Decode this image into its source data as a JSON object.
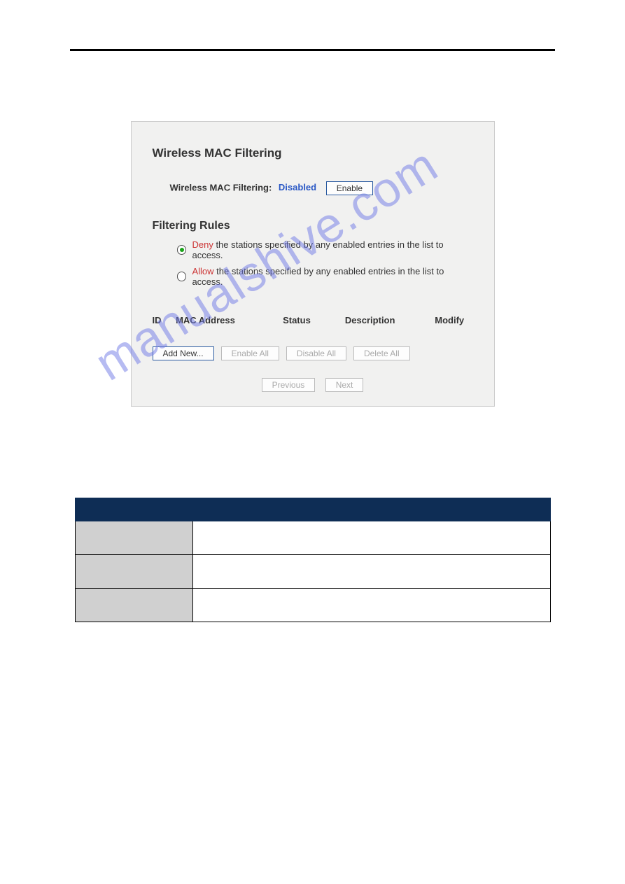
{
  "panel": {
    "title": "Wireless MAC Filtering",
    "status_label": "Wireless MAC Filtering:",
    "status_value": "Disabled",
    "enable_btn": "Enable",
    "rules_heading": "Filtering Rules",
    "rules": [
      {
        "selected": true,
        "key": "Deny",
        "rest": " the stations specified by any enabled entries in the list to access."
      },
      {
        "selected": false,
        "key": "Allow",
        "rest": " the stations specified by any enabled entries in the list to access."
      }
    ],
    "columns": {
      "id": "ID",
      "mac": "MAC Address",
      "status": "Status",
      "desc": "Description",
      "modify": "Modify"
    },
    "buttons": {
      "add": "Add New...",
      "enable_all": "Enable All",
      "disable_all": "Disable All",
      "delete_all": "Delete All"
    },
    "pager": {
      "prev": "Previous",
      "next": "Next"
    }
  },
  "watermark": "manualshive.com"
}
